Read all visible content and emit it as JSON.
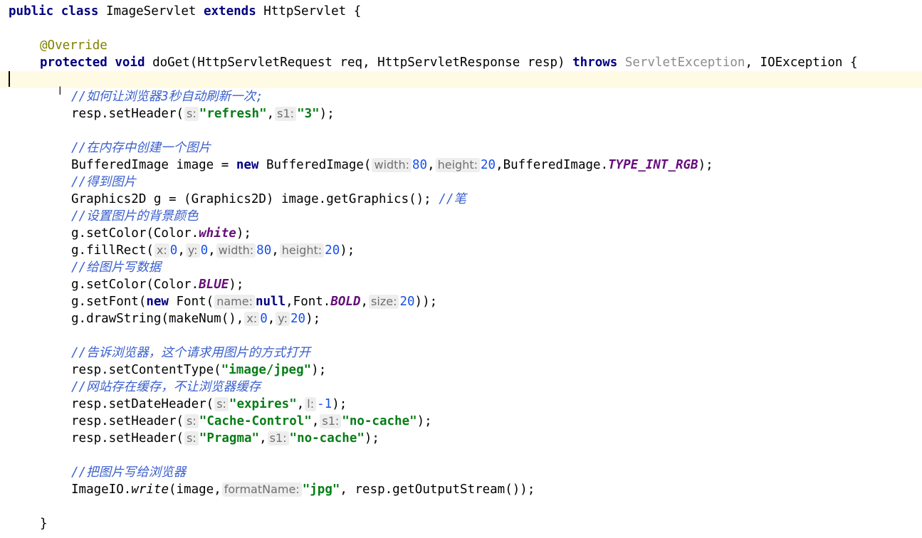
{
  "code": {
    "l1": {
      "kw_public": "public",
      "kw_class": "class",
      "class_name": "ImageServlet",
      "kw_extends": "extends",
      "super": "HttpServlet",
      "brace": "{"
    },
    "l2": {
      "annotation": "@Override"
    },
    "l3": {
      "kw_protected": "protected",
      "kw_void": "void",
      "method": "doGet(HttpServletRequest req, HttpServletResponse resp)",
      "kw_throws": "throws",
      "ex1": "ServletException",
      "sep": ",",
      "ex2": "IOException {"
    },
    "l4": {
      "comment": "//如何让浏览器3秒自动刷新一次;"
    },
    "l5": {
      "call": "resp.setHeader(",
      "h1": "s:",
      "a1": "\"refresh\"",
      "c1": ",",
      "h2": "s1:",
      "a2": "\"3\"",
      "end": ");"
    },
    "l6": {
      "comment": "//在内存中创建一个图片"
    },
    "l7": {
      "p1": "BufferedImage image =",
      "kw_new": "new",
      "p2": "BufferedImage(",
      "h1": "width:",
      "n1": "80",
      "c1": ",",
      "h2": "height:",
      "n2": "20",
      "p3": ",BufferedImage.",
      "f1": "TYPE_INT_RGB",
      "end": ");"
    },
    "l8": {
      "comment": "//得到图片"
    },
    "l9": {
      "code": "Graphics2D g = (Graphics2D) image.getGraphics();",
      "comment": "//笔"
    },
    "l10": {
      "comment": "//设置图片的背景颜色"
    },
    "l11": {
      "p1": "g.setColor(Color.",
      "f1": "white",
      "end": ");"
    },
    "l12": {
      "p1": "g.fillRect(",
      "h1": "x:",
      "n1": "0",
      "c1": ",",
      "h2": "y:",
      "n2": "0",
      "c2": ",",
      "h3": "width:",
      "n3": "80",
      "c3": ",",
      "h4": "height:",
      "n4": "20",
      "end": ");"
    },
    "l13": {
      "comment": "//给图片写数据"
    },
    "l14": {
      "p1": "g.setColor(Color.",
      "f1": "BLUE",
      "end": ");"
    },
    "l15": {
      "p1": "g.setFont(",
      "kw_new": "new",
      "p2": "Font(",
      "h1": "name:",
      "kw_null": "null",
      "p3": ",Font.",
      "f1": "BOLD",
      "c1": ",",
      "h2": "size:",
      "n1": "20",
      "end": "));"
    },
    "l16": {
      "p1": "g.drawString(makeNum(),",
      "h1": "x:",
      "n1": "0",
      "c1": ",",
      "h2": "y:",
      "n2": "20",
      "end": ");"
    },
    "l17": {
      "comment": "//告诉浏览器，这个请求用图片的方式打开"
    },
    "l18": {
      "p1": "resp.setContentType(",
      "s1": "\"image/jpeg\"",
      "end": ");"
    },
    "l19": {
      "comment": "//网站存在缓存，不让浏览器缓存"
    },
    "l20": {
      "p1": "resp.setDateHeader(",
      "h1": "s:",
      "s1": "\"expires\"",
      "c1": ",",
      "h2": "l:",
      "n1": "-1",
      "end": ");"
    },
    "l21": {
      "p1": "resp.setHeader(",
      "h1": "s:",
      "s1": "\"Cache-Control\"",
      "c1": ",",
      "h2": "s1:",
      "s2": "\"no-cache\"",
      "end": ");"
    },
    "l22": {
      "p1": "resp.setHeader(",
      "h1": "s:",
      "s1": "\"Pragma\"",
      "c1": ",",
      "h2": "s1:",
      "s2": "\"no-cache\"",
      "end": ");"
    },
    "l23": {
      "comment": "//把图片写给浏览器"
    },
    "l24": {
      "p1": "ImageIO.",
      "m1": "write",
      "p2": "(image,",
      "h1": "formatName:",
      "s1": "\"jpg\"",
      "p3": ", resp.getOutputStream());"
    },
    "l25": {
      "brace": "}"
    }
  },
  "cursor_glyph": "I",
  "colors": {
    "keyword": "#000080",
    "string": "#067d17",
    "number": "#1750eb",
    "comment": "#3a5fcd",
    "field": "#660e7a",
    "annotation": "#808000",
    "hint": "#707070",
    "current_line": "#fffae3"
  }
}
